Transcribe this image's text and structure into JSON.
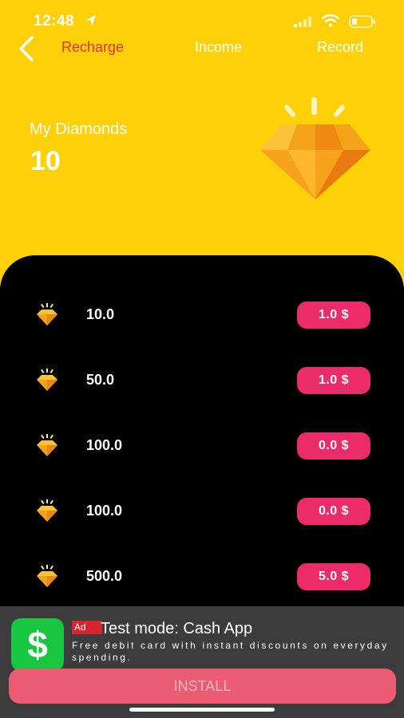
{
  "status_bar": {
    "time": "12:48",
    "icons": [
      "location-arrow-icon",
      "signal-icon",
      "wifi-icon",
      "battery-icon"
    ]
  },
  "nav": {
    "back_icon": "chevron-left-icon",
    "tabs": [
      {
        "label": "Recharge",
        "active": true
      },
      {
        "label": "Income",
        "active": false
      },
      {
        "label": "Record",
        "active": false
      }
    ]
  },
  "diamonds": {
    "label": "My Diamonds",
    "value": "10",
    "icon": "diamond-icon"
  },
  "packages": [
    {
      "amount": "10.0",
      "price": "1.0 $"
    },
    {
      "amount": "50.0",
      "price": "1.0 $"
    },
    {
      "amount": "100.0",
      "price": "0.0 $"
    },
    {
      "amount": "100.0",
      "price": "0.0 $"
    },
    {
      "amount": "500.0",
      "price": "5.0 $"
    }
  ],
  "ad": {
    "icon_glyph": "$",
    "badge": "Ad",
    "title": "Test mode: Cash App",
    "description": "Free debit card with instant discounts on everyday spending.",
    "install_label": "INSTALL"
  },
  "colors": {
    "header_yellow": "#FDD00A",
    "active_tab": "#E5323A",
    "price_pink": "#EC2B6A",
    "ad_background": "#3C3C3C",
    "install_button": "#EB5B72",
    "cash_app_green": "#19C63F"
  }
}
